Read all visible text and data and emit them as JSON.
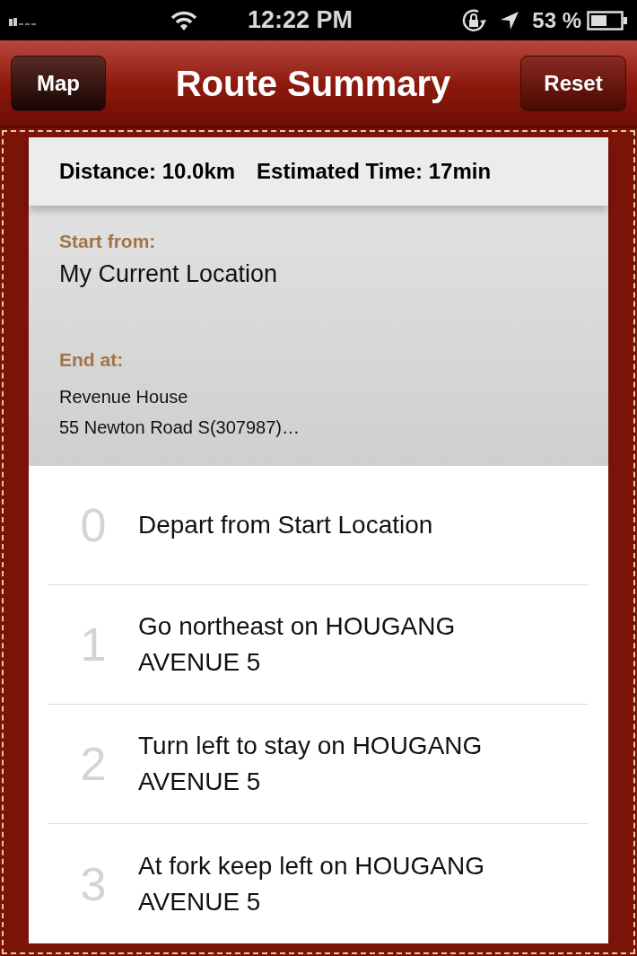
{
  "status_bar": {
    "time": "12:22 PM",
    "battery": "53 %"
  },
  "nav_bar": {
    "title": "Route Summary",
    "left_button": "Map",
    "right_button": "Reset"
  },
  "summary": {
    "distance": "Distance: 10.0km",
    "time": "Estimated Time: 17min"
  },
  "start": {
    "label": "Start from:",
    "value": "My Current Location"
  },
  "end": {
    "label": "End at:",
    "lines": [
      "Revenue House",
      "55 Newton Road S(307987)…"
    ]
  },
  "steps": [
    {
      "number": "0",
      "text": "Depart from Start Location"
    },
    {
      "number": "1",
      "text": "Go northeast on HOUGANG AVENUE 5"
    },
    {
      "number": "2",
      "text": "Turn left to stay on HOUGANG AVENUE 5"
    },
    {
      "number": "3",
      "text": "At fork keep left on HOUGANG AVENUE 5"
    }
  ]
}
